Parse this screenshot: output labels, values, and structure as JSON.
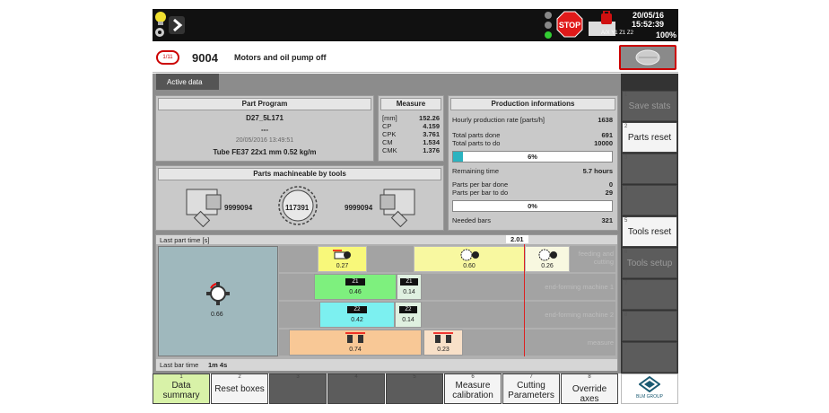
{
  "topbar": {
    "date": "20/05/16",
    "time": "15:52:39",
    "axes": "A/X Y1 Z1 Z2",
    "percent": "100%",
    "stop_label": "STOP"
  },
  "header": {
    "alarm_badge": "1/11",
    "code": "9004",
    "message": "Motors and oil pump off"
  },
  "tabs": {
    "active": "Active data"
  },
  "part_program": {
    "title": "Part Program",
    "name": "D27_5L171",
    "dash": "---",
    "datetime": "20/05/2016 13:49:51",
    "material": "Tube  FE37  22x1 mm  0.52 kg/m"
  },
  "measure": {
    "title": "Measure",
    "rows": [
      {
        "label": "[mm]",
        "value": "152.26"
      },
      {
        "label": "CP",
        "value": "4.159"
      },
      {
        "label": "CPK",
        "value": "3.761"
      },
      {
        "label": "CM",
        "value": "1.534"
      },
      {
        "label": "CMK",
        "value": "1.376"
      }
    ]
  },
  "production": {
    "title": "Production informations",
    "rate_label": "Hourly production rate [parts/h]",
    "rate_value": "1638",
    "done_label": "Total parts done",
    "done_value": "691",
    "todo_label": "Total parts to do",
    "todo_value": "10000",
    "progress1_label": "6%",
    "progress1": 0.06,
    "remaining_label": "Remaining time",
    "remaining_value": "5.7 hours",
    "perbar_done_label": "Parts per bar done",
    "perbar_done_value": "0",
    "perbar_todo_label": "Parts per bar to do",
    "perbar_todo_value": "29",
    "progress2_label": "0%",
    "progress2": 0.0,
    "bars_label": "Needed bars",
    "bars_value": "321"
  },
  "tools": {
    "title": "Parts machineable by tools",
    "left": "9999094",
    "center": "117391",
    "right": "9999094"
  },
  "timeline": {
    "last_part_label": "Last part time [s]",
    "last_part_value": "2.01",
    "last_bar_label": "Last bar time",
    "last_bar_value": "1m 4s",
    "main_value": "0.66",
    "lanes": [
      {
        "label": "feeding and cutting"
      },
      {
        "label": "end-forming machine 1"
      },
      {
        "label": "end-forming machine 2"
      },
      {
        "label": "measure"
      }
    ],
    "blocks": {
      "feed1": "0.27",
      "cut": "0.60",
      "feed2": "0.26",
      "z1a_tag": "Z1",
      "z1a": "0.46",
      "z1b_tag": "Z1",
      "z1b": "0.14",
      "z2a_tag": "Z2",
      "z2a": "0.42",
      "z2b_tag": "Z2",
      "z2b": "0.14",
      "meas1": "0.74",
      "meas2": "0.23"
    },
    "colors": {
      "feed": "#f8f87a",
      "cut": "#f8f8a0",
      "z1": "#7ef07e",
      "z2": "#7cf0f0",
      "meas": "#f8c896",
      "light": "#dff0e0"
    }
  },
  "right_buttons": [
    {
      "num": "1",
      "label": "Save stats",
      "enabled": false
    },
    {
      "num": "2",
      "label": "Parts reset",
      "enabled": true
    },
    {
      "num": "3",
      "label": "",
      "enabled": false
    },
    {
      "num": "4",
      "label": "",
      "enabled": false
    },
    {
      "num": "5",
      "label": "Tools reset",
      "enabled": true
    },
    {
      "num": "6",
      "label": "Tools setup",
      "enabled": false
    },
    {
      "num": "7",
      "label": "",
      "enabled": false
    },
    {
      "num": "8",
      "label": "",
      "enabled": false
    },
    {
      "num": "",
      "label": "",
      "enabled": false
    }
  ],
  "bottom_buttons": [
    {
      "num": "1",
      "label1": "Data",
      "label2": "summary"
    },
    {
      "num": "2",
      "label1": "Reset boxes",
      "label2": ""
    },
    {
      "num": "3",
      "label1": "",
      "label2": ""
    },
    {
      "num": "4",
      "label1": "",
      "label2": ""
    },
    {
      "num": "5",
      "label1": "",
      "label2": ""
    },
    {
      "num": "6",
      "label1": "Measure",
      "label2": "calibration"
    },
    {
      "num": "7",
      "label1": "Cutting",
      "label2": "Parameters"
    },
    {
      "num": "8",
      "label1": "Override axes",
      "label2": ""
    }
  ],
  "brand": "BLM GROUP"
}
